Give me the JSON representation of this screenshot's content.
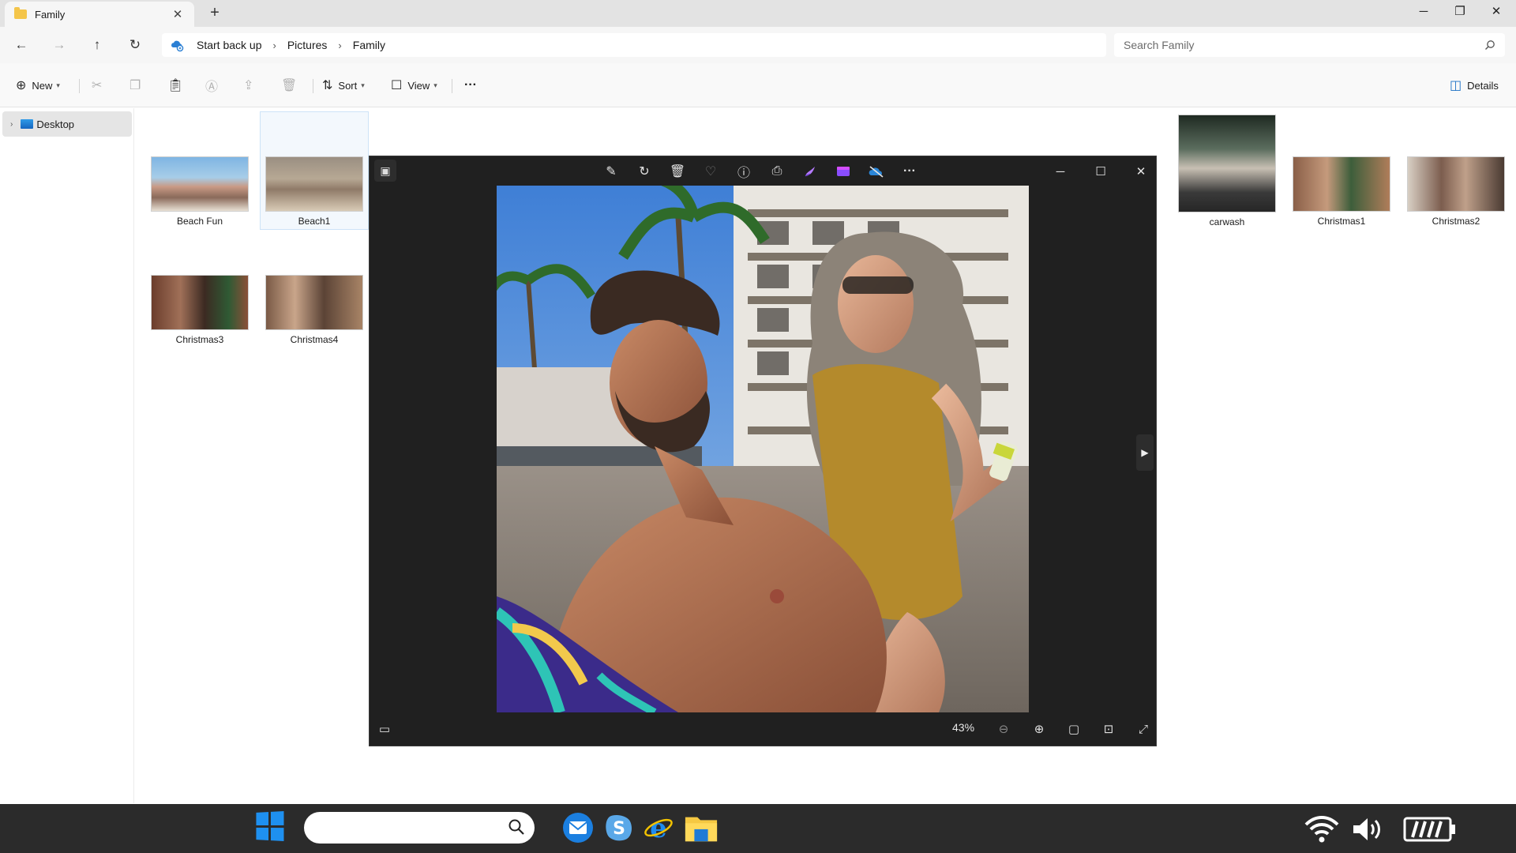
{
  "window": {
    "tab_title": "Family",
    "tab_close": "✕",
    "new_tab": "+",
    "minimize": "─",
    "restore": "❐",
    "close": "✕"
  },
  "nav": {
    "back": "←",
    "forward": "→",
    "up": "↑",
    "refresh": "↻"
  },
  "address": {
    "backup_label": "Start back up",
    "breadcrumbs": [
      "Pictures",
      "Family"
    ],
    "separator": "›"
  },
  "search": {
    "placeholder": "Search Family"
  },
  "toolbar": {
    "new_label": "New",
    "sort_label": "Sort",
    "view_label": "View",
    "more_label": "···",
    "details_label": "Details"
  },
  "sidebar": {
    "items": [
      {
        "label": "Desktop"
      }
    ]
  },
  "files": [
    {
      "name": "Beach Fun"
    },
    {
      "name": "Beach1"
    },
    {
      "name": "Christmas3"
    },
    {
      "name": "Christmas4"
    },
    {
      "name": "carwash"
    },
    {
      "name": "Christmas1"
    },
    {
      "name": "Christmas2"
    }
  ],
  "viewer": {
    "zoom": "43%",
    "more": "···",
    "minimize": "─",
    "maximize": "☐",
    "close": "✕"
  },
  "colors": {
    "accent": "#0067c0",
    "viewer_bg": "#202020",
    "taskbar_bg": "#2b2b2b"
  }
}
